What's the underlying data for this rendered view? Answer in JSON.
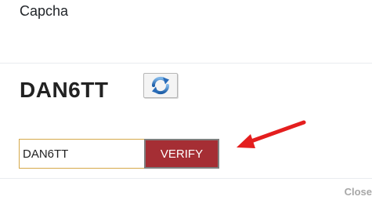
{
  "header": {
    "title": "Capcha"
  },
  "captcha": {
    "code": "DAN6TT",
    "refresh_icon": "refresh-icon"
  },
  "form": {
    "input_value": "DAN6TT",
    "verify_label": "VERIFY"
  },
  "footer": {
    "close_label": "Close"
  },
  "colors": {
    "verify_bg": "#a52e34",
    "annotation_arrow": "#e41e1e",
    "input_border": "#d6a94a"
  }
}
